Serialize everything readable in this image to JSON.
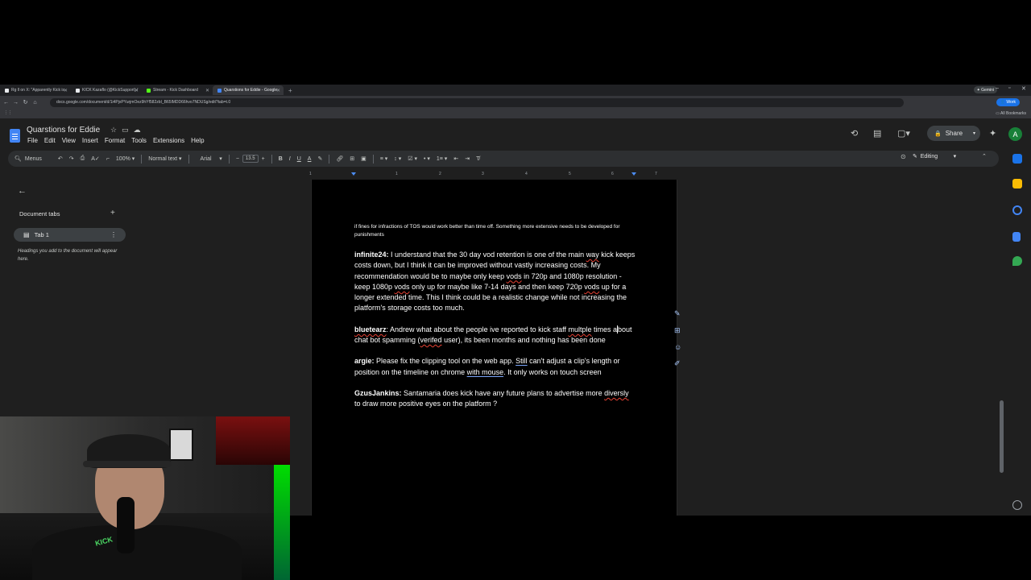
{
  "browser": {
    "tabs": [
      {
        "label": "Rg ll on X: \"Apparently Kick is",
        "color": "#e8eaed"
      },
      {
        "label": "KICK Kazaflo (@KickSupport) /",
        "color": "#e8eaed"
      },
      {
        "label": "Stream - Kick Dashboard",
        "color": "#53fc18"
      },
      {
        "label": "Quarstions for Eddie - Google",
        "color": "#4285f4"
      }
    ],
    "gemini_label": "Gemini",
    "url": "docs.google.com/document/d/1i4PjxPYurjmOez9hYf582zbI_B65lMDD66hvo7NDUSg/edit?tab=t.0",
    "work_label": "Work",
    "all_bookmarks": "All Bookmarks"
  },
  "docs": {
    "title": "Quarstions for Eddie",
    "menus": [
      "File",
      "Edit",
      "View",
      "Insert",
      "Format",
      "Tools",
      "Extensions",
      "Help"
    ],
    "share_label": "Share",
    "avatar_letter": "A",
    "toolbar": {
      "menus_search": "Menus",
      "zoom": "100%",
      "style": "Normal text",
      "font": "Arial",
      "font_size": "13.5"
    },
    "mode": "Editing",
    "ruler_numbers": [
      "1",
      "1",
      "2",
      "3",
      "4",
      "5",
      "6",
      "7"
    ]
  },
  "outline": {
    "heading": "Document tabs",
    "tab_label": "Tab 1",
    "hint": "Headings you add to the document will appear here."
  },
  "content": {
    "intro_small": "if fines for infractions of TOS would work better than time off. Something more extensive needs to be developed for punishments",
    "entries": [
      {
        "user": "infinite24:",
        "parts": [
          " I understand that the 30 day vod retention is one of the main ",
          "way",
          " kick keeps costs down, but I think it can be improved without vastly increasing costs. My recommendation would be to maybe only keep ",
          "vods",
          " in 720p and 1080p resolution - keep 1080p ",
          "vods",
          " only up for maybe like 7-14 days and then keep 720p ",
          "vods",
          " up for a longer extended time. This I think could be a realistic change while not increasing the platform's storage costs too much."
        ]
      },
      {
        "user": "bluetearz",
        "parts": [
          ": Andrew what about the people ive reported to kick staff ",
          "multple",
          " times a",
          "bout chat bot spamming (",
          "verifed",
          " user), its been months and nothing has been done"
        ]
      },
      {
        "user": "argie:",
        "parts": [
          " Please fix the clipping tool on the web app. ",
          "Still",
          " can't adjust a clip's length or position on the timeline on chrome ",
          "with mouse",
          ". It only works on touch screen"
        ]
      },
      {
        "user": "GzusJankins:",
        "parts": [
          " Santamaria does kick have any future plans to advertise more ",
          "diversly",
          " to draw more positive eyes on the platform ?"
        ]
      }
    ]
  },
  "webcam": {
    "shirt_text": "KICK"
  },
  "colors": {
    "docs_bg": "#1f1f1f",
    "page_bg": "#000000",
    "accent": "#4285f4",
    "spell_error": "#e94235"
  }
}
